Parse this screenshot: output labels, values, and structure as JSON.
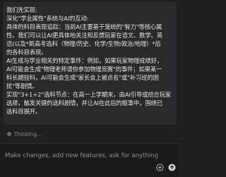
{
  "chat": {
    "message_lines": [
      "我们先实现:",
      "深化\"学业属性\"系统与AI的互动:",
      "具体的科目表现追踪：当前AI主要基于笼统的\"智力\"等核心属",
      "性。我们可以让AI更具体地关注和反馈玩家在语文、数学、英",
      "语(以及*新高考选科（物理/历史、化学/生物/政治/地理）*后",
      "的各科目表现。",
      "AI生成与学业相关的特定事件：例如，如果玩家物理成绩好，",
      "AI可能会生成\"物理老师请你参加物理竞赛\"的事件；如果某一",
      "科长期挂科，AI可能会生成\"家长会上被点名\"或\"补习班的困",
      "扰\"等剧情。",
      "实现\"3+1+2\"选科节点：在高一上学期末，由AI引导或结合玩家",
      "选择，触发关键的选科剧情，并让AI在此后的叙事中，围绕已",
      "选科目展开。"
    ]
  },
  "status": {
    "text": "Thinking..."
  },
  "composer": {
    "placeholder": "Make changes, add new features, ask for anything",
    "value": ""
  },
  "icons": {
    "attach": "attach-icon",
    "send": "send-icon"
  }
}
